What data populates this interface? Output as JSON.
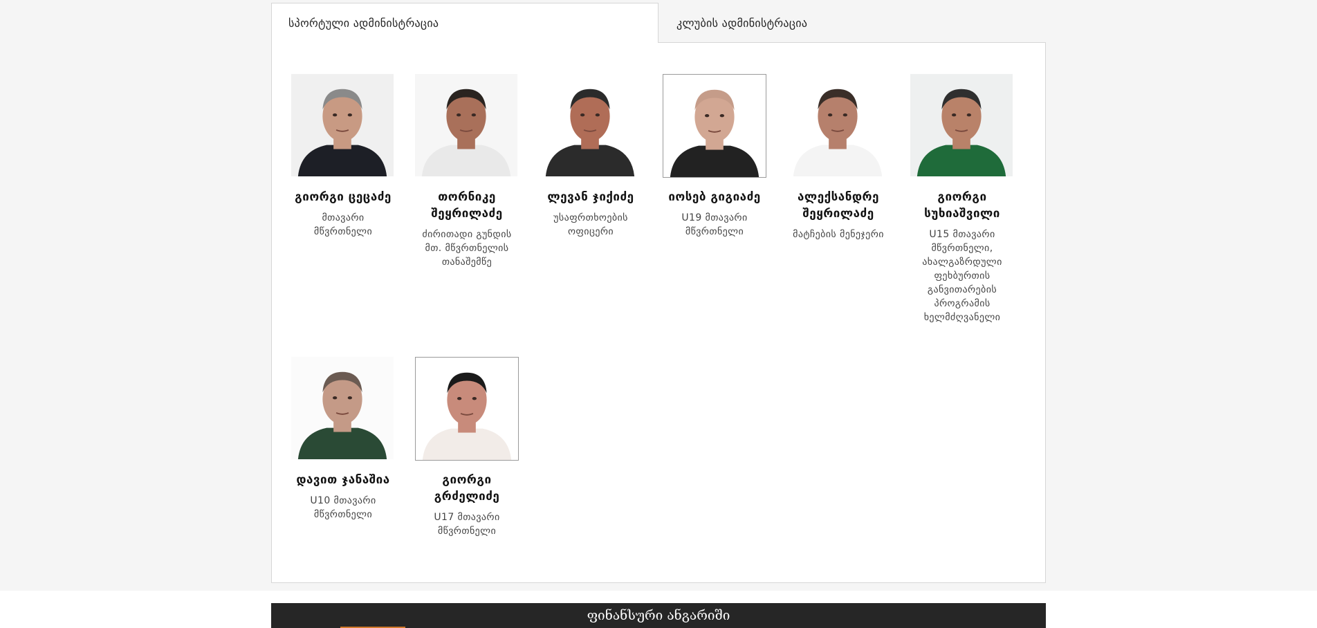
{
  "tabs": [
    {
      "label": "სპორტული ადმინისტრაცია",
      "active": true
    },
    {
      "label": "კლუბის ადმინისტრაცია",
      "active": false
    }
  ],
  "staff": [
    {
      "name": "გიორგი ცეცაძე",
      "role": "მთავარი მწვრთნელი",
      "shirt": "#1d1f26",
      "skin": "#c89a83",
      "bg": "#f0f0f0",
      "hair": "#8a8a8a"
    },
    {
      "name": "თორნიკე შეყრილაძე",
      "role": "ძირითადი გუნდის მთ. მწვრთნელის თანაშემწე",
      "shirt": "#e9e9e9",
      "skin": "#a9705a",
      "bg": "#f6f6f6",
      "hair": "#2a2420"
    },
    {
      "name": "ლევან ჯიქიძე",
      "role": "უსაფრთხოების ოფიცერი",
      "shirt": "#2b2b2b",
      "skin": "#b06d57",
      "bg": "#ffffff",
      "hair": "#2b2b2b"
    },
    {
      "name": "იოსებ გიგიაძე",
      "role": "U19 მთავარი მწვრთნელი",
      "shirt": "#222222",
      "skin": "#d2a793",
      "bg": "#ffffff",
      "hair": "#c59c89"
    },
    {
      "name": "ალექსანდრე შეყრილაძე",
      "role": "მატჩების მენეჯერი",
      "shirt": "#f4f4f4",
      "skin": "#b6806c",
      "bg": "#ffffff",
      "hair": "#3a2e28"
    },
    {
      "name": "გიორგი სუხიაშვილი",
      "role": "U15 მთავარი მწვრთნელი, ახალგაზრდული ფეხბურთის განვითარების პროგრამის ხელმძღვანელი",
      "shirt": "#1f6b3a",
      "skin": "#b98269",
      "bg": "#eef0f0",
      "hair": "#2f2f2f"
    },
    {
      "name": "დავით ჯანაშია",
      "role": "U10 მთავარი მწვრთნელი",
      "shirt": "#2a4a35",
      "skin": "#c49a87",
      "bg": "#fbfbfb",
      "hair": "#6b5b52"
    },
    {
      "name": "გიორგი გრძელიძე",
      "role": "U17 მთავარი მწვრთნელი",
      "shirt": "#f2ece8",
      "skin": "#c88b7b",
      "bg": "#ffffff",
      "hair": "#1a1a1a"
    }
  ],
  "footer": {
    "title": "ფინანსური ანგარიში"
  }
}
